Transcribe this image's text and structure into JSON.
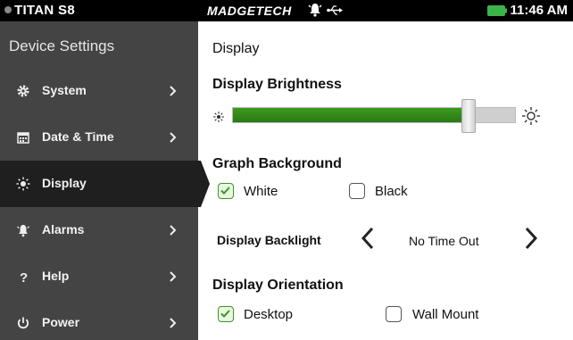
{
  "status_bar": {
    "model": "TITAN S8",
    "brand": "MADGETECH",
    "time": "11:46 AM",
    "icons": [
      "alarm-bell-icon",
      "usb-icon",
      "battery-icon"
    ]
  },
  "sidebar": {
    "title": "Device Settings",
    "items": [
      {
        "label": "System",
        "icon": "gear-icon"
      },
      {
        "label": "Date & Time",
        "icon": "calendar-icon"
      },
      {
        "label": "Display",
        "icon": "sun-icon",
        "active": true
      },
      {
        "label": "Alarms",
        "icon": "alarm-bell-icon"
      },
      {
        "label": "Help",
        "icon": "question-icon"
      },
      {
        "label": "Power",
        "icon": "power-icon"
      }
    ]
  },
  "main": {
    "breadcrumb": "Display",
    "brightness": {
      "title": "Display Brightness",
      "level_fraction": 0.83
    },
    "graph_background": {
      "title": "Graph Background",
      "options": [
        {
          "label": "White",
          "checked": true
        },
        {
          "label": "Black",
          "checked": false
        }
      ]
    },
    "backlight": {
      "label": "Display Backlight",
      "value": "No Time Out"
    },
    "orientation": {
      "title": "Display Orientation",
      "options": [
        {
          "label": "Desktop",
          "checked": true
        },
        {
          "label": "Wall Mount",
          "checked": false
        }
      ]
    }
  },
  "colors": {
    "accent_green": "#3a9a20",
    "sidebar_bg": "#444444",
    "active_bg": "#1f1f1f"
  }
}
